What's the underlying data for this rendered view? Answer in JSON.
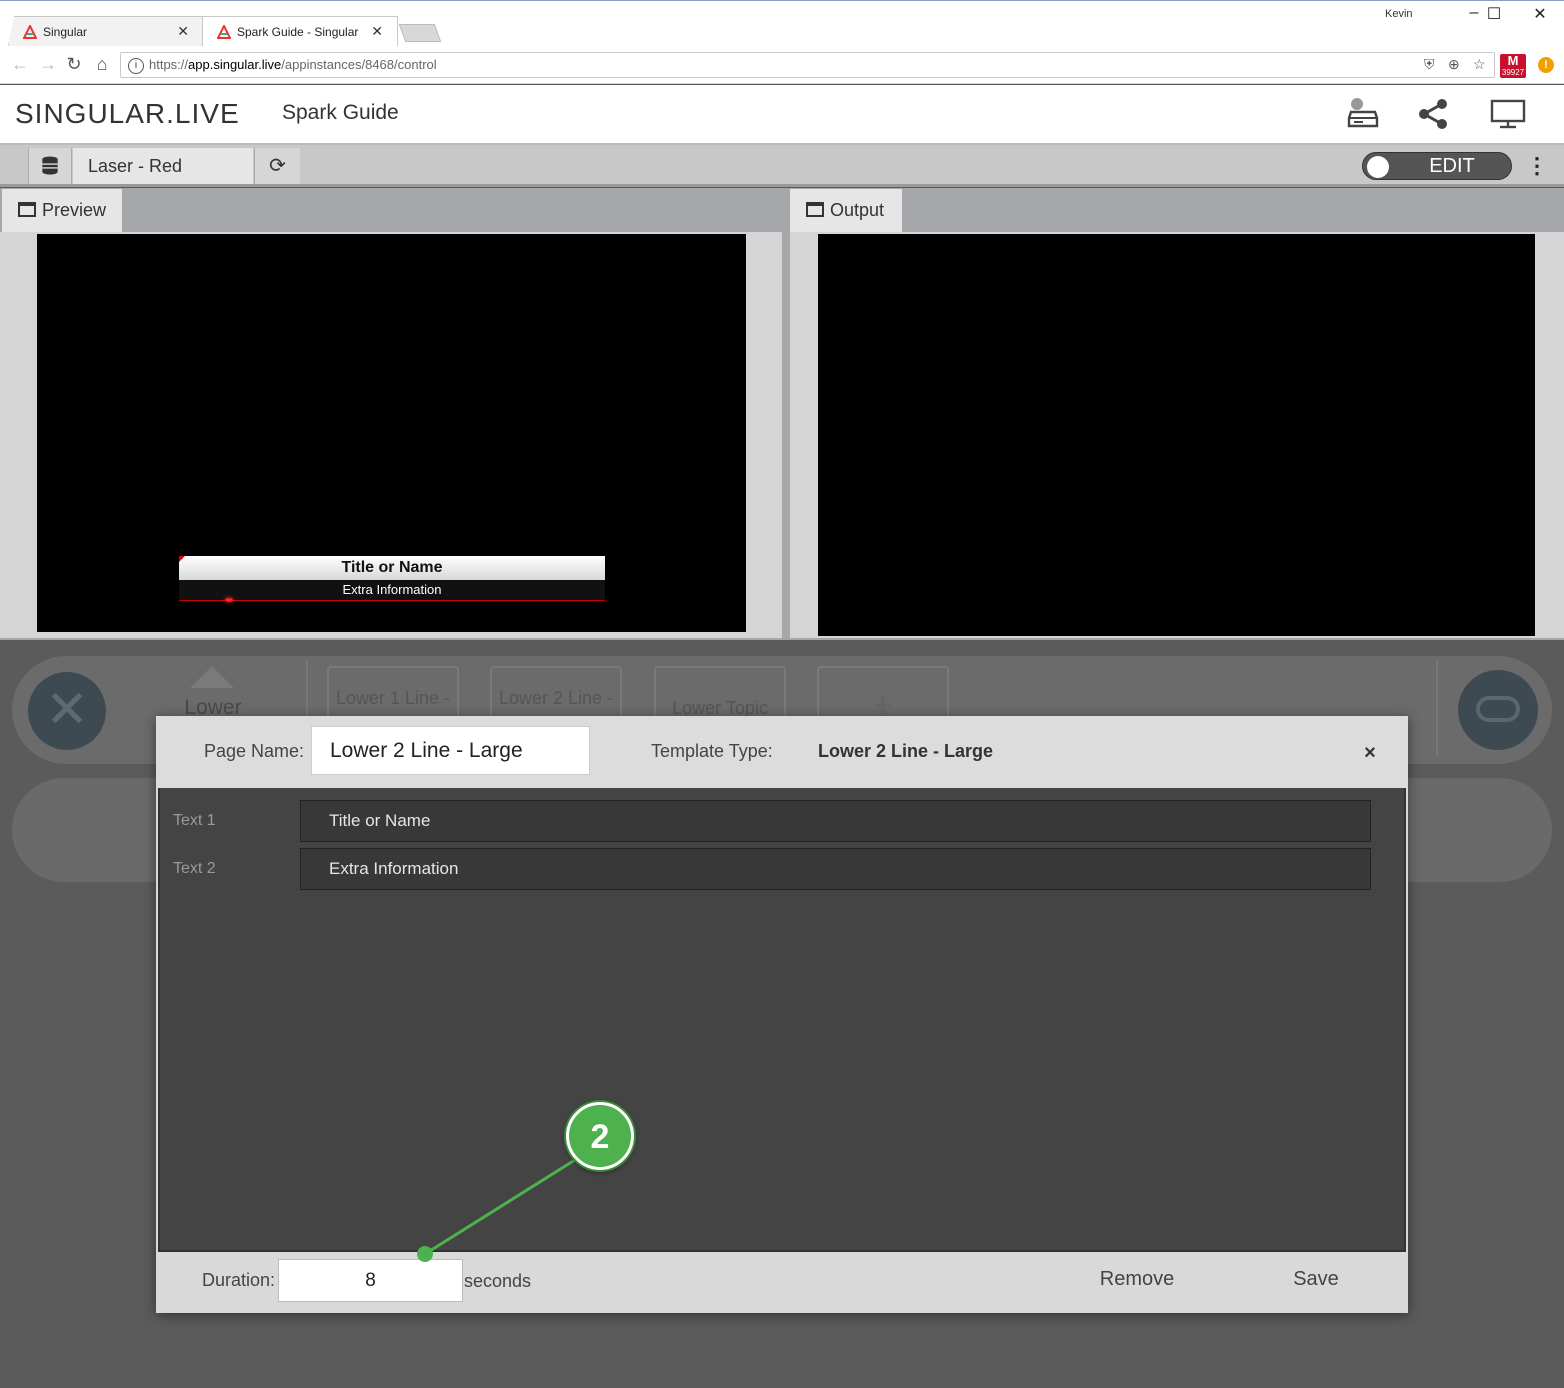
{
  "browser": {
    "tabs": [
      {
        "label": "Singular"
      },
      {
        "label": "Spark Guide - Singular"
      }
    ],
    "user": "Kevin",
    "url_scheme": "https://",
    "url_host": "app.singular.live",
    "url_path": "/appinstances/8468/control",
    "gmail_count": "39927",
    "window_controls": {
      "minimize": "–",
      "maximize": "☐",
      "close": "✕"
    }
  },
  "header": {
    "brand": "SINGULAR.LIVE",
    "project_name": "Spark Guide"
  },
  "toolbar": {
    "composition": "Laser - Red",
    "mode_label": "EDIT"
  },
  "panels": {
    "preview_label": "Preview",
    "output_label": "Output"
  },
  "preview_graphic": {
    "title": "Title or Name",
    "subtitle": "Extra Information"
  },
  "control": {
    "lower_label": "Lower",
    "cards": [
      "Lower 1 Line -",
      "Lower 2 Line -",
      "Lower Topic",
      "+"
    ]
  },
  "dialog": {
    "page_name_label": "Page Name:",
    "page_name_value": "Lower 2 Line - Large",
    "template_type_label": "Template Type:",
    "template_type_value": "Lower 2 Line - Large",
    "close": "×",
    "fields": [
      {
        "label": "Text 1",
        "value": "Title or Name"
      },
      {
        "label": "Text 2",
        "value": "Extra Information"
      }
    ],
    "duration_label": "Duration:",
    "duration_value": "8",
    "duration_unit": "seconds",
    "remove_label": "Remove",
    "save_label": "Save"
  },
  "annotation": {
    "step": "2",
    "color": "#4db24d"
  },
  "colors": {
    "accent_green": "#4db24d",
    "toggle_bg": "#555555",
    "dialog_body": "#444444"
  }
}
